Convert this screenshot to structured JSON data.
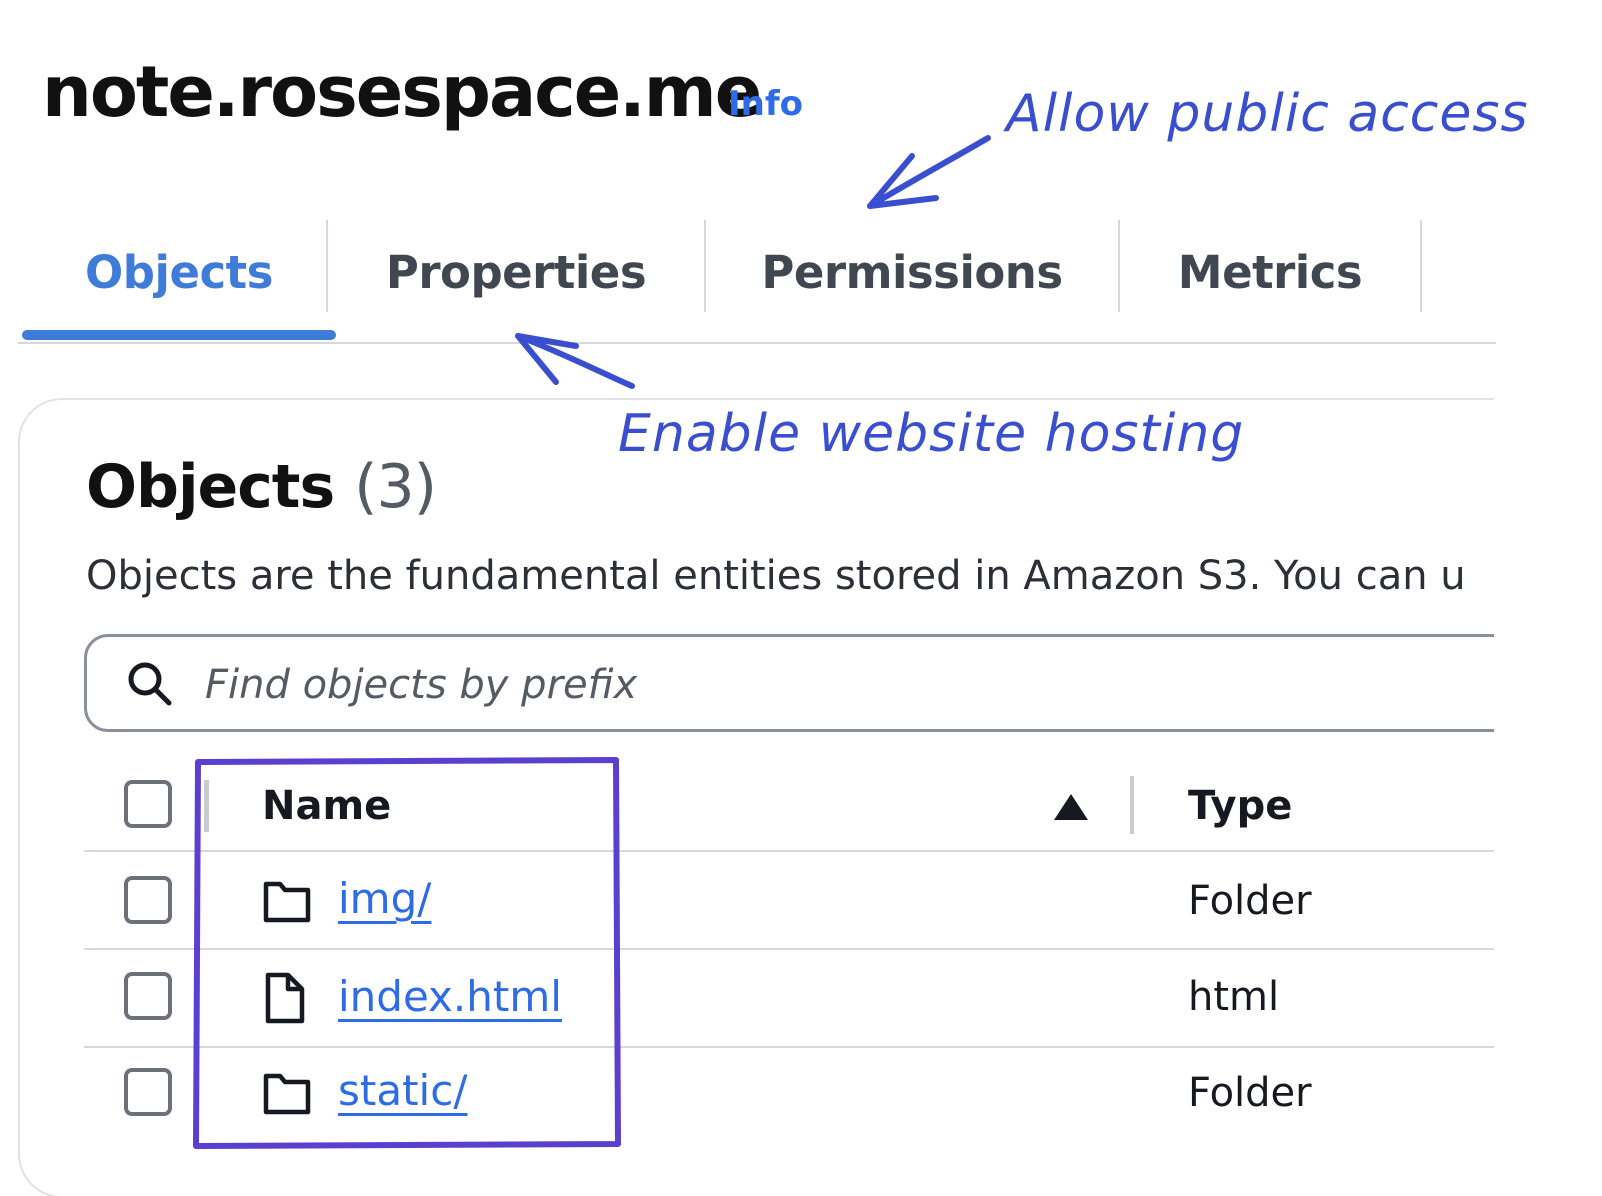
{
  "header": {
    "bucket_name": "note.rosespace.me",
    "info_label": "Info"
  },
  "tabs": [
    {
      "label": "Objects",
      "active": true
    },
    {
      "label": "Properties",
      "active": false
    },
    {
      "label": "Permissions",
      "active": false
    },
    {
      "label": "Metrics",
      "active": false
    }
  ],
  "objects_section": {
    "title": "Objects",
    "count": "(3)",
    "description": "Objects are the fundamental entities stored in Amazon S3. You can u",
    "search": {
      "placeholder": "Find objects by prefix",
      "value": ""
    },
    "table": {
      "columns": [
        {
          "label": "Name",
          "sort": "ascending"
        },
        {
          "label": "Type"
        }
      ],
      "rows": [
        {
          "name": "img/",
          "type": "Folder",
          "icon": "folder-icon"
        },
        {
          "name": "index.html",
          "type": "html",
          "icon": "file-icon"
        },
        {
          "name": "static/",
          "type": "Folder",
          "icon": "folder-icon"
        }
      ]
    }
  },
  "annotations": {
    "permissions_note": "Allow public access",
    "properties_note": "Enable website hosting",
    "ink_color": "#3a4fcf",
    "highlight_color": "#5b3fd0"
  },
  "colors": {
    "accent": "#3f7bd8",
    "link": "#2e6be6"
  }
}
